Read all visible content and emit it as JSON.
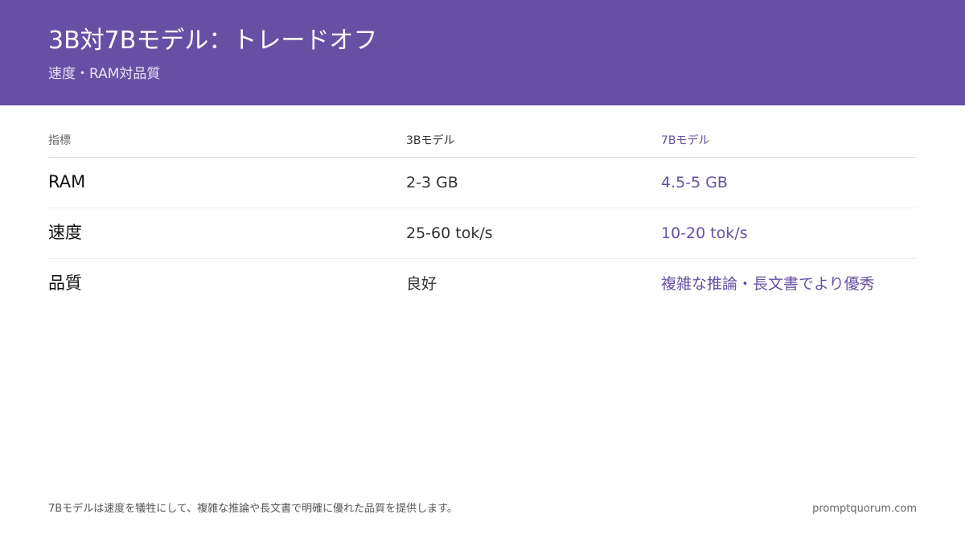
{
  "header": {
    "title": "3B対7Bモデル：トレードオフ",
    "subtitle": "速度・RAM対品質"
  },
  "table": {
    "columns": [
      "指標",
      "3Bモデル",
      "7Bモデル"
    ],
    "rows": [
      [
        "RAM",
        "2-3 GB",
        "4.5-5 GB"
      ],
      [
        "速度",
        "25-60 tok/s",
        "10-20 tok/s"
      ],
      [
        "品質",
        "良好",
        "複雑な推論・長文書でより優秀"
      ]
    ]
  },
  "footer": {
    "note": "7Bモデルは速度を犠牲にして、複雑な推論や長文書で明確に優れた品質を提供します。",
    "brand": "promptquorum.com"
  },
  "colors": {
    "accent": "#6750a4",
    "header_text": "#ffffff"
  }
}
